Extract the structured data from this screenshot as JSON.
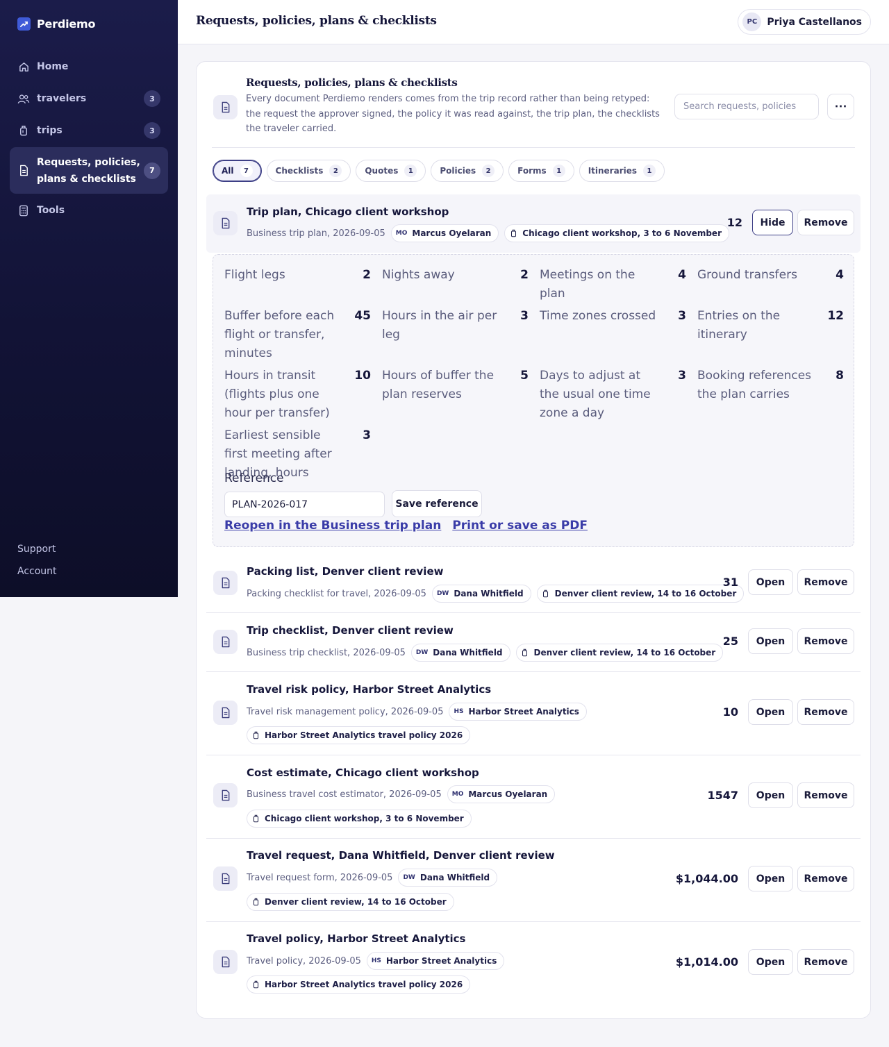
{
  "app": {
    "name": "Perdiemo",
    "page_title": "Requests, policies, plans & checklists"
  },
  "nav": {
    "items": [
      {
        "label": "Home",
        "count": ""
      },
      {
        "label": "travelers",
        "count": "3"
      },
      {
        "label": "trips",
        "count": "3"
      },
      {
        "label": "Requests, policies, plans & checklists",
        "count": "7"
      },
      {
        "label": "Tools",
        "count": ""
      }
    ],
    "footer": {
      "support": "Support",
      "account": "Account"
    }
  },
  "user": {
    "initials": "PC",
    "name": "Priya Castellanos"
  },
  "card": {
    "title": "Requests, policies, plans & checklists",
    "description": "Every document Perdiemo renders comes from the trip record rather than being retyped: the request the approver signed, the policy it was read against, the trip plan, the checklists the traveler carried.",
    "search_placeholder": "Search requests, policies",
    "more_label": "⋯"
  },
  "filters": [
    {
      "label": "All",
      "count": "7"
    },
    {
      "label": "Checklists",
      "count": "2"
    },
    {
      "label": "Quotes",
      "count": "1"
    },
    {
      "label": "Policies",
      "count": "2"
    },
    {
      "label": "Forms",
      "count": "1"
    },
    {
      "label": "Itineraries",
      "count": "1"
    }
  ],
  "rows": [
    {
      "title": "Trip plan, Chicago client workshop",
      "meta": "Business trip plan, 2026-09-05",
      "person_initials": "MO",
      "person": "Marcus Oyelaran",
      "trip": "Chicago client workshop, 3 to 6 November",
      "value": "12",
      "action": "Hide",
      "remove": "Remove"
    },
    {
      "title": "Packing list, Denver client review",
      "meta": "Packing checklist for travel, 2026-09-05",
      "person_initials": "DW",
      "person": "Dana Whitfield",
      "trip": "Denver client review, 14 to 16 October",
      "value": "31",
      "action": "Open",
      "remove": "Remove"
    },
    {
      "title": "Trip checklist, Denver client review",
      "meta": "Business trip checklist, 2026-09-05",
      "person_initials": "DW",
      "person": "Dana Whitfield",
      "trip": "Denver client review, 14 to 16 October",
      "value": "25",
      "action": "Open",
      "remove": "Remove"
    },
    {
      "title": "Travel risk policy, Harbor Street Analytics",
      "meta": "Travel risk management policy, 2026-09-05",
      "person_initials": "HS",
      "person": "Harbor Street Analytics",
      "trip": "Harbor Street Analytics travel policy 2026",
      "value": "10",
      "action": "Open",
      "remove": "Remove"
    },
    {
      "title": "Cost estimate, Chicago client workshop",
      "meta": "Business travel cost estimator, 2026-09-05",
      "person_initials": "MO",
      "person": "Marcus Oyelaran",
      "trip": "Chicago client workshop, 3 to 6 November",
      "value": "1547",
      "action": "Open",
      "remove": "Remove"
    },
    {
      "title": "Travel request, Dana Whitfield, Denver client review",
      "meta": "Travel request form, 2026-09-05",
      "person_initials": "DW",
      "person": "Dana Whitfield",
      "trip": "Denver client review, 14 to 16 October",
      "value": "$1,044.00",
      "action": "Open",
      "remove": "Remove"
    },
    {
      "title": "Travel policy, Harbor Street Analytics",
      "meta": "Travel policy, 2026-09-05",
      "person_initials": "HS",
      "person": "Harbor Street Analytics",
      "trip": "Harbor Street Analytics travel policy 2026",
      "value": "$1,014.00",
      "action": "Open",
      "remove": "Remove"
    }
  ],
  "plan_detail": {
    "stats": [
      {
        "label": "Flight legs",
        "value": "2"
      },
      {
        "label": "Nights away",
        "value": "2"
      },
      {
        "label": "Meetings on the plan",
        "value": "4"
      },
      {
        "label": "Ground transfers",
        "value": "4"
      },
      {
        "label": "Buffer before each flight or transfer, minutes",
        "value": "45"
      },
      {
        "label": "Hours in the air per leg",
        "value": "3"
      },
      {
        "label": "Time zones crossed",
        "value": "3"
      },
      {
        "label": "Entries on the itinerary",
        "value": "12"
      },
      {
        "label": "Hours in transit (flights plus one hour per transfer)",
        "value": "10"
      },
      {
        "label": "Hours of buffer the plan reserves",
        "value": "5"
      },
      {
        "label": "Days to adjust at the usual one time zone a day",
        "value": "3"
      },
      {
        "label": "Booking references the plan carries",
        "value": "8"
      },
      {
        "label": "Earliest sensible first meeting after landing, hours",
        "value": "3"
      }
    ],
    "reference_label": "Reference",
    "reference_value": "PLAN-2026-017",
    "save_label": "Save reference",
    "reopen_link": "Reopen in the Business trip plan",
    "print_link": "Print or save as PDF"
  }
}
